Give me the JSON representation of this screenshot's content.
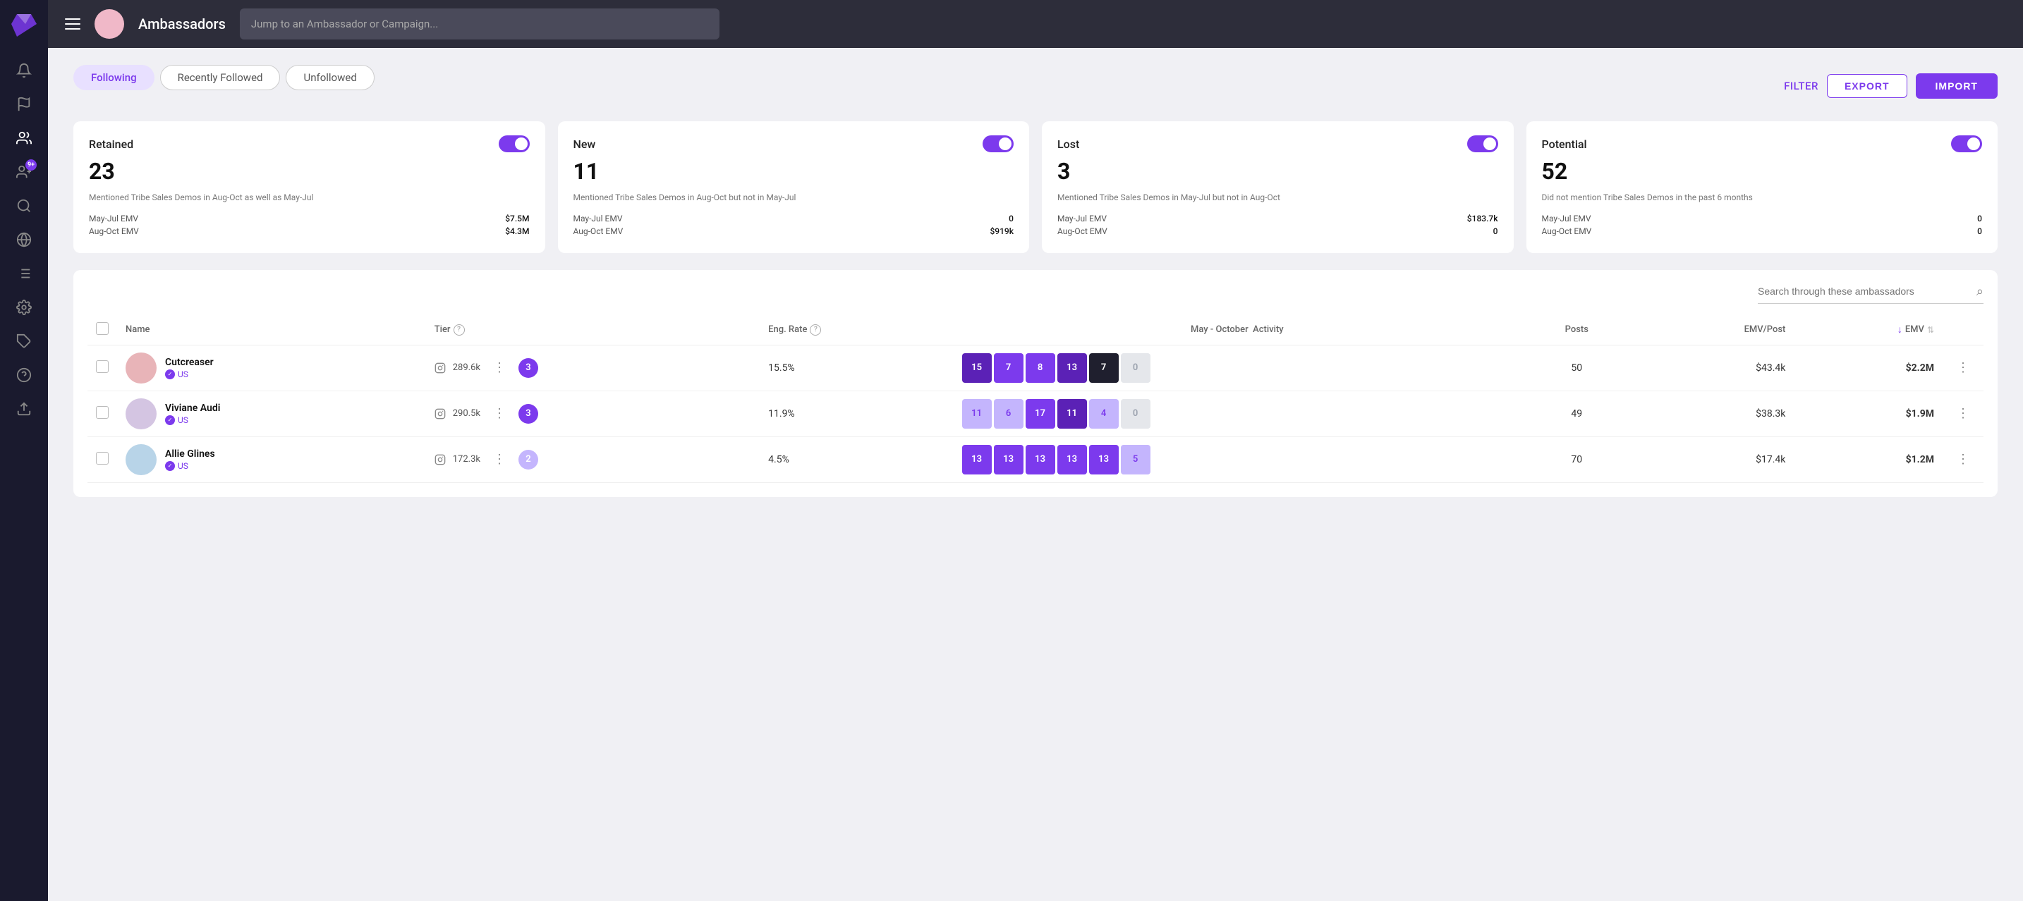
{
  "app": {
    "title": "Ambassadors",
    "searchPlaceholder": "Jump to an Ambassador or Campaign..."
  },
  "tabs": [
    {
      "id": "following",
      "label": "Following",
      "active": true
    },
    {
      "id": "recently-followed",
      "label": "Recently Followed",
      "active": false
    },
    {
      "id": "unfollowed",
      "label": "Unfollowed",
      "active": false
    }
  ],
  "actions": {
    "filter": "FILTER",
    "export": "EXPORT",
    "import": "IMPORT"
  },
  "cards": [
    {
      "id": "retained",
      "title": "Retained",
      "number": "23",
      "description": "Mentioned Tribe Sales Demos in Aug-Oct as well as May-Jul",
      "stats": [
        {
          "label": "May-Jul EMV",
          "value": "$7.5M"
        },
        {
          "label": "Aug-Oct EMV",
          "value": "$4.3M"
        }
      ]
    },
    {
      "id": "new",
      "title": "New",
      "number": "11",
      "description": "Mentioned Tribe Sales Demos in Aug-Oct but not in May-Jul",
      "stats": [
        {
          "label": "May-Jul EMV",
          "value": "0"
        },
        {
          "label": "Aug-Oct EMV",
          "value": "$919k"
        }
      ]
    },
    {
      "id": "lost",
      "title": "Lost",
      "number": "3",
      "description": "Mentioned Tribe Sales Demos in May-Jul but not in Aug-Oct",
      "stats": [
        {
          "label": "May-Jul EMV",
          "value": "$183.7k"
        },
        {
          "label": "Aug-Oct EMV",
          "value": "0"
        }
      ]
    },
    {
      "id": "potential",
      "title": "Potential",
      "number": "52",
      "description": "Did not mention Tribe Sales Demos in the past 6 months",
      "stats": [
        {
          "label": "May-Jul EMV",
          "value": "0"
        },
        {
          "label": "Aug-Oct EMV",
          "value": "0"
        }
      ]
    }
  ],
  "table": {
    "searchPlaceholder": "Search through these ambassadors",
    "columns": {
      "name": "Name",
      "tier": "Tier",
      "engRate": "Eng. Rate",
      "period": "May - October",
      "activity": "Activity",
      "posts": "Posts",
      "emvPerPost": "EMV/Post",
      "emv": "EMV"
    },
    "rows": [
      {
        "id": 1,
        "name": "Cutcreaser",
        "country": "US",
        "followers": "289.6k",
        "tier": "3",
        "tierLight": false,
        "engRate": "15.5%",
        "activity": [
          {
            "val": "15",
            "style": "dark"
          },
          {
            "val": "7",
            "style": "mid"
          },
          {
            "val": "8",
            "style": "mid"
          },
          {
            "val": "13",
            "style": "dark"
          },
          {
            "val": "7",
            "style": "black"
          },
          {
            "val": "0",
            "style": "empty"
          }
        ],
        "posts": "50",
        "emvPerPost": "$43.4k",
        "emv": "$2.2M"
      },
      {
        "id": 2,
        "name": "Viviane Audi",
        "country": "US",
        "followers": "290.5k",
        "tier": "3",
        "tierLight": false,
        "engRate": "11.9%",
        "activity": [
          {
            "val": "11",
            "style": "light"
          },
          {
            "val": "6",
            "style": "light"
          },
          {
            "val": "17",
            "style": "mid"
          },
          {
            "val": "11",
            "style": "dark"
          },
          {
            "val": "4",
            "style": "light"
          },
          {
            "val": "0",
            "style": "empty"
          }
        ],
        "posts": "49",
        "emvPerPost": "$38.3k",
        "emv": "$1.9M"
      },
      {
        "id": 3,
        "name": "Allie Glines",
        "country": "US",
        "followers": "172.3k",
        "tier": "2",
        "tierLight": true,
        "engRate": "4.5%",
        "activity": [
          {
            "val": "13",
            "style": "mid"
          },
          {
            "val": "13",
            "style": "mid"
          },
          {
            "val": "13",
            "style": "mid"
          },
          {
            "val": "13",
            "style": "mid"
          },
          {
            "val": "13",
            "style": "mid"
          },
          {
            "val": "5",
            "style": "light"
          }
        ],
        "posts": "70",
        "emvPerPost": "$17.4k",
        "emv": "$1.2M"
      }
    ]
  },
  "sidebar": {
    "items": [
      {
        "id": "notifications",
        "icon": "bell"
      },
      {
        "id": "flag",
        "icon": "flag"
      },
      {
        "id": "people",
        "icon": "people",
        "active": true
      },
      {
        "id": "add-person",
        "icon": "person-add",
        "badge": "9+"
      },
      {
        "id": "search",
        "icon": "search"
      },
      {
        "id": "globe",
        "icon": "globe"
      },
      {
        "id": "list",
        "icon": "list"
      },
      {
        "id": "settings",
        "icon": "settings"
      },
      {
        "id": "tag",
        "icon": "tag"
      },
      {
        "id": "help",
        "icon": "help"
      },
      {
        "id": "export",
        "icon": "export"
      }
    ]
  }
}
